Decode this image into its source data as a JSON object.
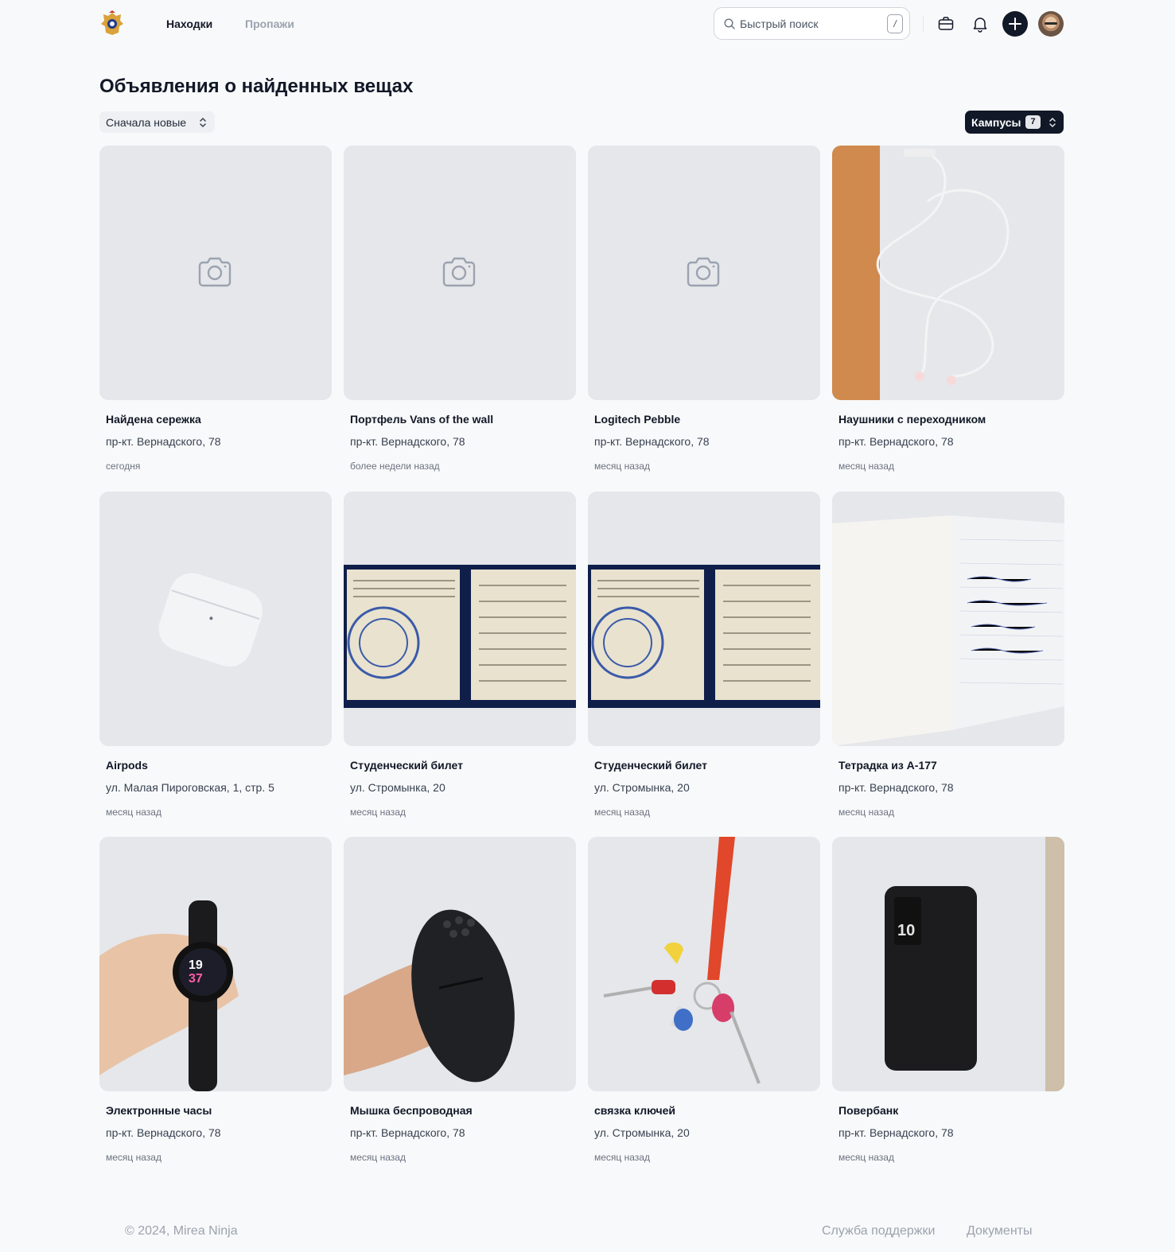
{
  "header": {
    "logo_icon": "coat-of-arms-icon",
    "nav": [
      {
        "label": "Находки",
        "active": true
      },
      {
        "label": "Пропажи",
        "active": false
      }
    ],
    "search": {
      "placeholder": "Быстрый поиск",
      "shortcut": "/"
    },
    "icons": [
      "briefcase-icon",
      "bell-icon",
      "plus-icon",
      "avatar"
    ]
  },
  "page": {
    "title": "Объявления о найденных вещах",
    "sort_label": "Сначала новые",
    "campus_label": "Кампусы",
    "campus_count": "7"
  },
  "items": [
    {
      "title": "Найдена сережка",
      "address": "пр-кт. Вернадского, 78",
      "time": "сегодня",
      "photo": "placeholder"
    },
    {
      "title": "Портфель Vans of the wall",
      "address": "пр-кт. Вернадского, 78",
      "time": "более недели назад",
      "photo": "placeholder"
    },
    {
      "title": "Logitech Pebble",
      "address": "пр-кт. Вернадского, 78",
      "time": "месяц назад",
      "photo": "placeholder"
    },
    {
      "title": "Наушники с переходником",
      "address": "пр-кт. Вернадского, 78",
      "time": "месяц назад",
      "photo": "earphones"
    },
    {
      "title": "Airpods",
      "address": "ул. Малая Пироговская, 1, стр. 5",
      "time": "месяц назад",
      "photo": "airpods"
    },
    {
      "title": "Студенческий билет",
      "address": "ул. Стромынка, 20",
      "time": "месяц назад",
      "photo": "student-id"
    },
    {
      "title": "Студенческий билет",
      "address": "ул. Стромынка, 20",
      "time": "месяц назад",
      "photo": "student-id"
    },
    {
      "title": "Тетрадка из А-177",
      "address": "пр-кт. Вернадского, 78",
      "time": "месяц назад",
      "photo": "notebook"
    },
    {
      "title": "Электронные часы",
      "address": "пр-кт. Вернадского, 78",
      "time": "месяц назад",
      "photo": "smartwatch"
    },
    {
      "title": "Мышка беспроводная",
      "address": "пр-кт. Вернадского, 78",
      "time": "месяц назад",
      "photo": "mouse"
    },
    {
      "title": "связка ключей",
      "address": "ул. Стромынка, 20",
      "time": "месяц назад",
      "photo": "keys"
    },
    {
      "title": "Повербанк",
      "address": "пр-кт. Вернадского, 78",
      "time": "месяц назад",
      "photo": "powerbank"
    }
  ],
  "footer": {
    "copyright": "© 2024, Mirea Ninja",
    "links": [
      "Служба поддержки",
      "Документы"
    ]
  },
  "colors": {
    "background": "#f8f9fa",
    "primary": "#111827",
    "muted": "#9ca3af",
    "placeholder": "#e5e7eb"
  }
}
